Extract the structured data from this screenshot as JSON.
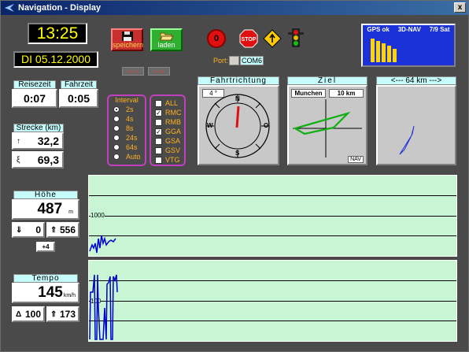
{
  "window": {
    "title": "Navigation - Display",
    "close": "x"
  },
  "clock": {
    "time": "13:25",
    "date": "DI 05.12.2000"
  },
  "buttons": {
    "save": "speichern",
    "load": "laden",
    "stop": "STOP"
  },
  "nav_arrows": {
    "left": "< >",
    "right": "> >"
  },
  "port": {
    "label": "Port:",
    "value": "COM6"
  },
  "times": {
    "reise_label": "Reisezeit",
    "reise_value": "0:07",
    "fahr_label": "Fahrzeit",
    "fahr_value": "0:05"
  },
  "distance": {
    "label": "Strecke (km)",
    "row1_icon": "↑",
    "row1_value": "32,2",
    "row2_icon": "ξ",
    "row2_value": "69,3"
  },
  "interval": {
    "title": "Interval",
    "options": [
      "2s",
      "4s",
      "8s",
      "24s",
      "64s",
      "Auto"
    ],
    "selected": 0
  },
  "sentences": {
    "items": [
      {
        "label": "ALL",
        "checked": false
      },
      {
        "label": "RMC",
        "checked": true
      },
      {
        "label": "RMB",
        "checked": false
      },
      {
        "label": "GGA",
        "checked": true
      },
      {
        "label": "GSA",
        "checked": false
      },
      {
        "label": "GSV",
        "checked": false
      },
      {
        "label": "VTG",
        "checked": false
      }
    ]
  },
  "gps": {
    "status": "GPS ok",
    "mode": "3D-NAV",
    "sats": "7/9 Sat",
    "bars": [
      1.0,
      0.9,
      0.8,
      0.7,
      0.55
    ]
  },
  "heading": {
    "title": "Fahrtrichtung",
    "value": "4 °",
    "n": "N",
    "s": "S",
    "w": "W",
    "o": "O"
  },
  "ziel": {
    "title": "Ziel",
    "name": "Munchen",
    "dist": "10 km",
    "footer": "NAV"
  },
  "map": {
    "title": "<--- 64 km --->"
  },
  "hoehe": {
    "title": "Höhe",
    "value": "487",
    "unit": "m",
    "min_icon": "⇓",
    "min": "0",
    "max_icon": "⇑",
    "max": "556",
    "step": "+4"
  },
  "tempo": {
    "title": "Tempo",
    "value": "145",
    "unit": "km/h",
    "avg_icon": "Δ",
    "avg": "100",
    "max_icon": "⇑",
    "max": "173"
  },
  "chart_alt": {
    "label": "1000"
  },
  "chart_speed": {
    "label": "100"
  },
  "colors": {
    "accent": "#0a246a",
    "lcd_text": "#ffff00",
    "caption_bg": "#c6fbfb",
    "chart_bg": "#c8f5d4",
    "trace": "#0000cc"
  }
}
